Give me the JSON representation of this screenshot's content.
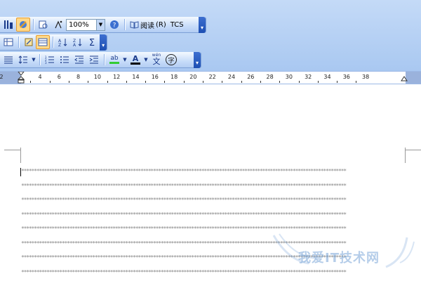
{
  "toolbar1": {
    "zoom_value": "100%",
    "read_label": "阅读",
    "read_shortcut": "(R)",
    "tcs_label": "TCS"
  },
  "toolbar3": {
    "highlight_glyph": "ab",
    "font_color_glyph": "A",
    "phonetic_glyph": "wén",
    "phonetic_char": "文",
    "enclose_char": "字"
  },
  "ruler": {
    "start_label": "2",
    "labels": [
      "2",
      "4",
      "6",
      "8",
      "10",
      "12",
      "14",
      "16",
      "18",
      "20",
      "22",
      "24",
      "26",
      "28",
      "30",
      "32",
      "34",
      "36",
      "38"
    ]
  },
  "document": {
    "placeholder_line": "********************************************************************************************************************************",
    "line_count": 8
  },
  "watermark": {
    "text": "我爱IT技术网"
  },
  "colors": {
    "toolbar_bg": "#c4daf7",
    "active_button": "#ffd98a",
    "grip": "#1d4fb3"
  }
}
